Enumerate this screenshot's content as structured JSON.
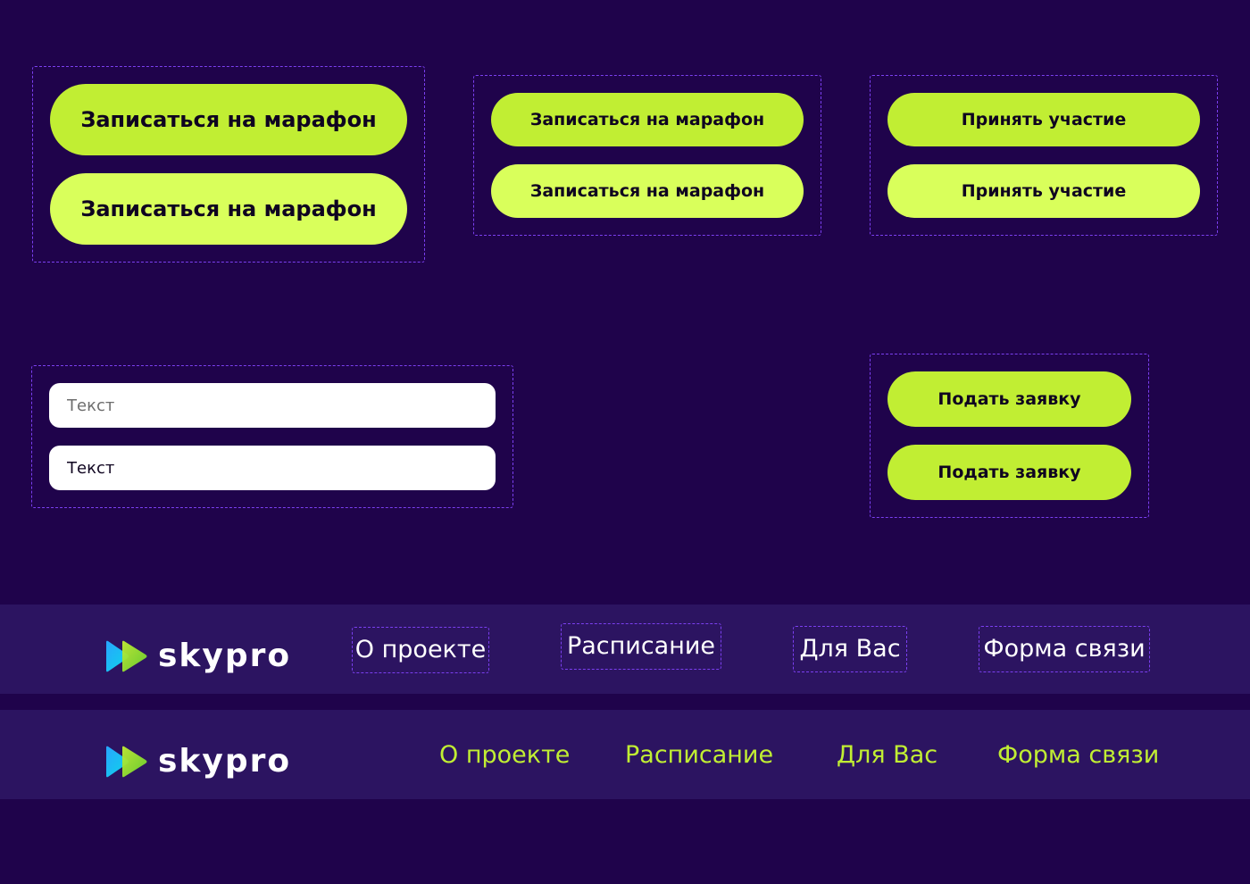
{
  "colors": {
    "background": "#1f034b",
    "accent": "#c1ee33",
    "accent_hover": "#d9ff5b",
    "frame_dashed": "#7b3ff0",
    "navbar": "#2c1461",
    "button_text": "#0f0420",
    "nav_link_active": "#ffffff",
    "nav_link_default": "#c1ee33"
  },
  "buttons": {
    "marathon_large": {
      "default_label": "Записаться на марафон",
      "hover_label": "Записаться на марафон"
    },
    "marathon_medium": {
      "default_label": "Записаться на марафон",
      "hover_label": "Записаться на марафон"
    },
    "participate": {
      "default_label": "Принять участие",
      "hover_label": "Принять участие"
    },
    "apply": {
      "default_label": "Подать заявку",
      "hover_label": "Подать заявку"
    }
  },
  "inputs": {
    "empty_placeholder": "Текст",
    "filled_value": "Текст"
  },
  "navbars": [
    {
      "logo_text": "skypro",
      "logo_icon": "play-double-arrow-icon",
      "links": [
        "О проекте",
        "Расписание",
        "Для Вас",
        "Форма связи"
      ]
    },
    {
      "logo_text": "skypro",
      "logo_icon": "play-double-arrow-icon",
      "links": [
        "О проекте",
        "Расписание",
        "Для Вас",
        "Форма связи"
      ]
    }
  ]
}
